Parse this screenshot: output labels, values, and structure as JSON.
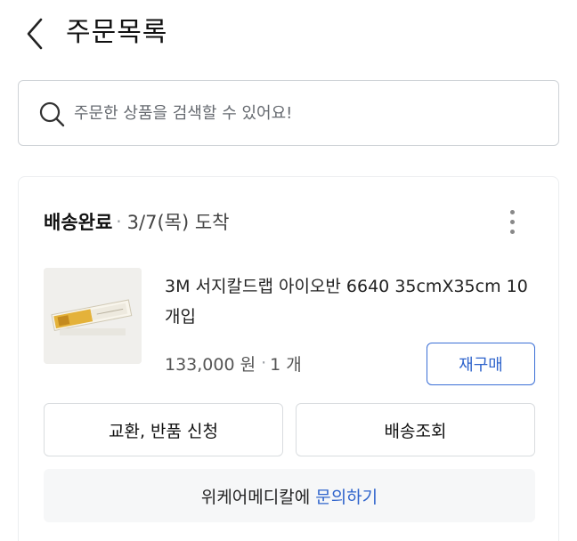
{
  "header": {
    "title": "주문목록",
    "back_icon": "chevron-left-icon"
  },
  "search": {
    "placeholder": "주문한 상품을 검색할 수 있어요!",
    "value": "",
    "icon": "search-icon"
  },
  "order": {
    "status": "배송완료",
    "separator": "·",
    "delivery_date": "3/7(목) 도착",
    "more_icon": "more-vertical-icon",
    "product": {
      "name": "3M 서지칼드랩 아이오반 6640 35cmX35cm 10개입",
      "price": "133,000 원",
      "quantity": "1 개"
    },
    "reorder_label": "재구매",
    "exchange_label": "교환, 반품 신청",
    "tracking_label": "배송조회",
    "inquiry": {
      "prefix": "위케어메디칼에",
      "link": "문의하기"
    }
  },
  "colors": {
    "accent": "#2f64cc",
    "border": "#d9dcdf",
    "muted_text": "#555555",
    "inquiry_bg": "#f6f7f8"
  }
}
